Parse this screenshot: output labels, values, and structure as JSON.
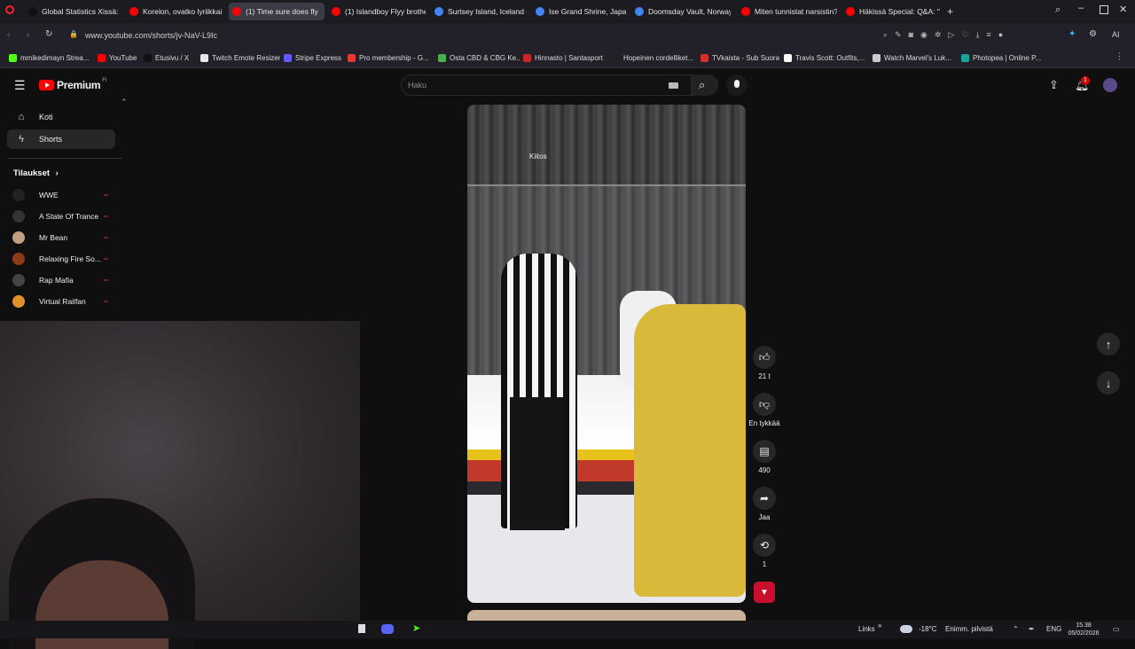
{
  "tabs": [
    {
      "label": "Global Statistics Xissä: \"Fo",
      "color": "#111111"
    },
    {
      "label": "Korelon, ovatko lyriikkai",
      "color": "#ff0000"
    },
    {
      "label": "(1) Time sure does fly",
      "color": "#ff0000",
      "active": true
    },
    {
      "label": "(1) Islandboy Flyy brother",
      "color": "#ff0000"
    },
    {
      "label": "Surtsey Island, Iceland - G",
      "color": "#4285f4"
    },
    {
      "label": "Ise Grand Shrine, Japan - G",
      "color": "#4285f4"
    },
    {
      "label": "Doomsday Vault, Norway",
      "color": "#4285f4"
    },
    {
      "label": "Miten tunnistat narsistin?",
      "color": "#ff0000"
    },
    {
      "label": "Häkissä Special: Q&A: \"Hä",
      "color": "#ff0000"
    }
  ],
  "address": {
    "url": "www.youtube.com/shorts/jv-NaV-L9Ic"
  },
  "bookmarks": [
    {
      "label": "mmikedimayn Strea...",
      "color": "#53fc18"
    },
    {
      "label": "YouTube",
      "color": "#ff0000"
    },
    {
      "label": "Etusivu / X",
      "color": "#111111"
    },
    {
      "label": "Twitch Emote Resizer",
      "color": "#e8e8e8"
    },
    {
      "label": "Stripe Express",
      "color": "#635bff"
    },
    {
      "label": "Pro membership - G...",
      "color": "#e53935"
    },
    {
      "label": "Osta CBD & CBG Ke...",
      "color": "#4caf50"
    },
    {
      "label": "Hinnasto | Santasport",
      "color": "#c62828"
    },
    {
      "label": "Hopeinen cordelliket...",
      "color": "#222222"
    },
    {
      "label": "TVkaista - Sub Suora",
      "color": "#d32f2f"
    },
    {
      "label": "Travis Scott: Outfits,...",
      "color": "#ffffff"
    },
    {
      "label": "Watch Marvel's Luk...",
      "color": "#cccccc"
    },
    {
      "label": "Photopea | Online P...",
      "color": "#18a497"
    }
  ],
  "youtube": {
    "logo_text": "Premium",
    "region": "FI",
    "search_placeholder": "Haku",
    "notification_count": "1",
    "sidebar": {
      "home": "Koti",
      "shorts": "Shorts",
      "subs_header": "Tilaukset",
      "subscriptions": [
        {
          "name": "WWE",
          "color": "#222222"
        },
        {
          "name": "A State Of Trance",
          "color": "#333333"
        },
        {
          "name": "Mr Bean",
          "color": "#c0a080"
        },
        {
          "name": "Relaxing Fire So...",
          "color": "#8b3a1a"
        },
        {
          "name": "Rap Mafia",
          "color": "#444444"
        },
        {
          "name": "Virtual Railfan",
          "color": "#e0922a"
        }
      ]
    },
    "video_overlay_text": "Kiitos",
    "actions": {
      "likes": "21 t",
      "dislike": "En tykkää",
      "comments": "490",
      "share": "Jaa",
      "remix": "1"
    }
  },
  "taskbar": {
    "links": "Links",
    "weather_temp": "-18°C",
    "weather_text": "Enimm. pilvistä",
    "lang": "ENG",
    "time": "15.38",
    "date": "05/02/2026"
  }
}
